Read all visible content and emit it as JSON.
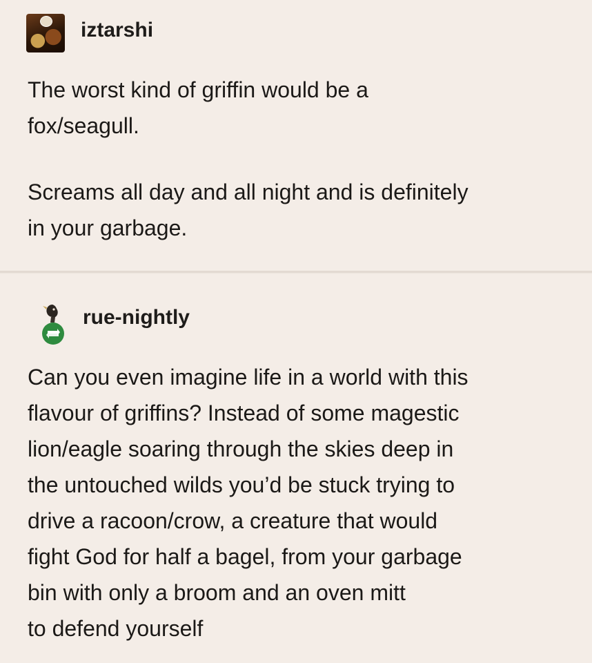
{
  "post1": {
    "username": "iztarshi",
    "paragraphs": [
      [
        "The worst kind of griffin would be a",
        "fox/seagull."
      ],
      [
        "Screams all day and all night and is definitely",
        "in your garbage."
      ]
    ]
  },
  "post2": {
    "username": "rue-nightly",
    "paragraphs": [
      [
        "Can you even imagine life in a world with this",
        "flavour of griffins? Instead of some magestic",
        "lion/eagle soaring through the skies deep in",
        "the untouched wilds you’d be stuck trying to",
        "drive a racoon/crow, a creature that would",
        "fight God for half a bagel, from your garbage",
        "bin with only a broom and an oven mitt",
        "to defend yourself"
      ]
    ]
  }
}
